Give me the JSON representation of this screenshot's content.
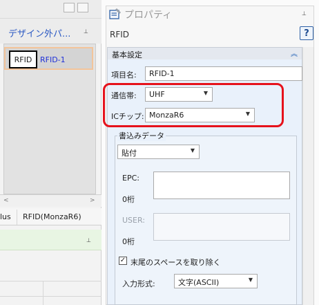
{
  "outer_panel": {
    "title": "デザイン外パ...",
    "pin": "⊥",
    "canvas": {
      "box_label": "RFID",
      "item_label": "RFID-1"
    },
    "scroll_left": "<",
    "scroll_right": ">",
    "tabs": [
      "lus",
      "RFID(MonzaR6)"
    ],
    "pin2": "⊥"
  },
  "properties": {
    "title": "プロパティ",
    "pin": "⊥",
    "object_label": "RFID",
    "help_glyph": "?",
    "category": {
      "title": "基本設定",
      "collapse_glyph": "︽",
      "item_name_label": "項目名:",
      "item_name_value": "RFID-1",
      "band_label": "通信帯:",
      "band_value": "UHF",
      "chip_label": "ICチップ:",
      "chip_value": "MonzaR6",
      "write_group": {
        "title": "書込みデータ",
        "mode_value": "貼付",
        "epc_label": "EPC:",
        "epc_count": "0桁",
        "user_label": "USER:",
        "user_count": "0桁",
        "trim_label": "末尾のスペースを取り除く",
        "trim_checked": true,
        "input_format_label": "入力形式:",
        "input_format_value": "文字(ASCII)"
      }
    }
  },
  "colors": {
    "accent": "#2b59c3",
    "highlight": "#e6121b",
    "category_body": "#e9f1fb",
    "link_text": "#1e2fd8"
  },
  "icons": [
    "pin-icon",
    "properties-icon",
    "help-icon",
    "chevron-up-icon",
    "dropdown-caret-icon",
    "checkmark-icon"
  ]
}
